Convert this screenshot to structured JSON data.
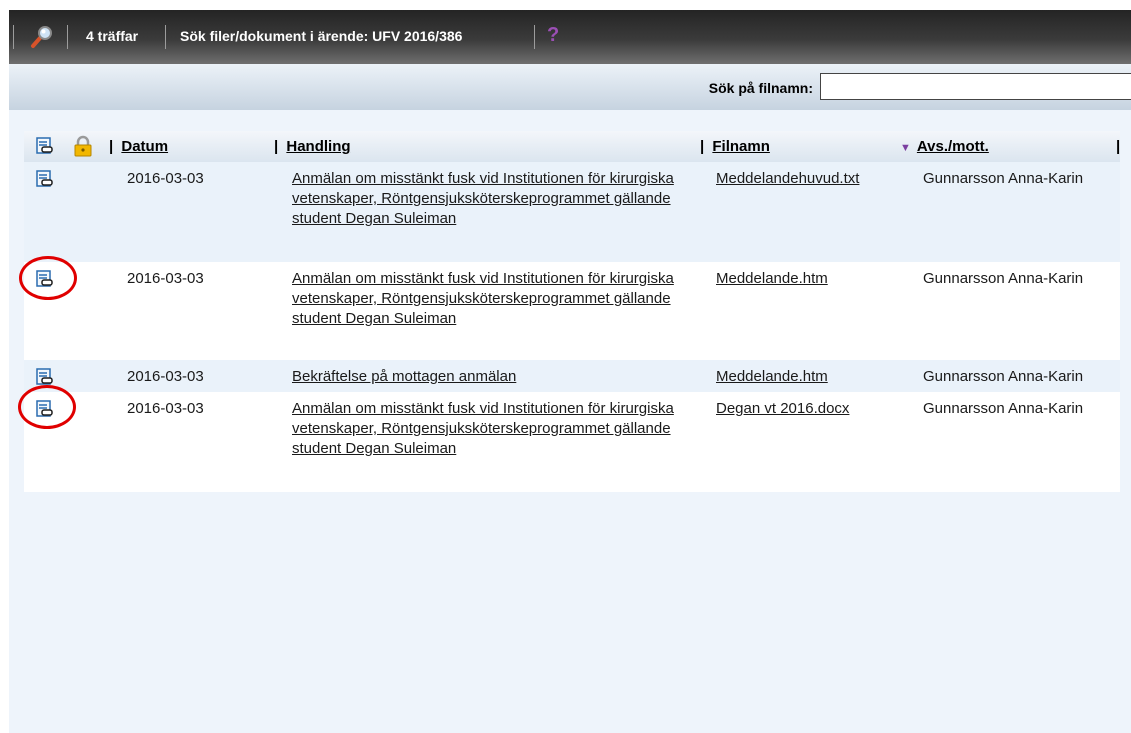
{
  "toolbar": {
    "hits": "4 träffar",
    "title": "Sök filer/dokument i ärende: UFV 2016/386",
    "icons": [
      "search-icon",
      "help-icon"
    ]
  },
  "search": {
    "label": "Sök på filnamn:",
    "value": ""
  },
  "columns": {
    "datum": "Datum",
    "handling": "Handling",
    "filnamn": "Filnamn",
    "avs": "Avs./mott.",
    "sort_indicator": "▼"
  },
  "rows": [
    {
      "datum": "2016-03-03",
      "handling": "Anmälan om misstänkt fusk vid Institutionen för kirurgiska vetenskaper, Röntgensjuksköterskeprogrammet gällande student Degan Suleiman",
      "filnamn": "Meddelandehuvud.txt",
      "avs": "Gunnarsson Anna-Karin"
    },
    {
      "datum": "2016-03-03",
      "handling": "Anmälan om misstänkt fusk vid Institutionen för kirurgiska vetenskaper, Röntgensjuksköterskeprogrammet gällande student Degan Suleiman",
      "filnamn": "Meddelande.htm",
      "avs": "Gunnarsson Anna-Karin"
    },
    {
      "datum": "2016-03-03",
      "handling": "Bekräftelse på mottagen anmälan",
      "filnamn": "Meddelande.htm",
      "avs": "Gunnarsson Anna-Karin"
    },
    {
      "datum": "2016-03-03",
      "handling": "Anmälan om misstänkt fusk vid Institutionen för kirurgiska vetenskaper, Röntgensjuksköterskeprogrammet gällande student Degan Suleiman",
      "filnamn": "Degan vt 2016.docx",
      "avs": "Gunnarsson Anna-Karin"
    }
  ],
  "colors": {
    "highlight_circle": "#e00000",
    "toolbar_bg": "#2b2b2b",
    "row_alt_bg": "#eaf2fa"
  }
}
